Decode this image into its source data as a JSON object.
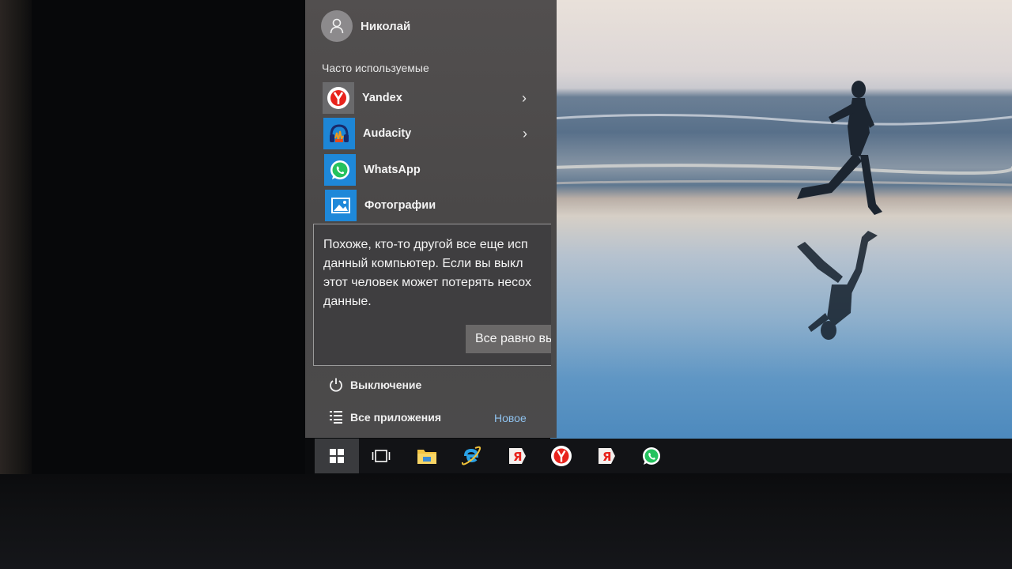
{
  "user": {
    "name": "Николай"
  },
  "start_menu": {
    "section_label": "Часто используемые",
    "apps": [
      {
        "label": "Yandex",
        "icon": "yandex-browser-icon",
        "has_submenu": true
      },
      {
        "label": "Audacity",
        "icon": "audacity-icon",
        "has_submenu": true
      },
      {
        "label": "WhatsApp",
        "icon": "whatsapp-icon",
        "has_submenu": false
      },
      {
        "label": "Фотографии",
        "icon": "photos-icon",
        "has_submenu": false
      }
    ],
    "power_label": "Выключение",
    "all_apps_label": "Все приложения",
    "new_label": "Новое"
  },
  "dialog": {
    "lines": [
      "Похоже, кто-то другой все еще исп",
      "данный компьютер. Если вы выкл",
      "этот человек может потерять несох",
      "данные."
    ],
    "button_label": "Все равно вы"
  },
  "taskbar": {
    "items": [
      "windows-start-icon",
      "task-view-icon",
      "file-explorer-icon",
      "internet-explorer-icon",
      "yandex-icon",
      "yandex-browser-icon",
      "yandex-icon",
      "whatsapp-icon"
    ]
  },
  "colors": {
    "menu_bg": "#4b4a4b",
    "tile_blue": "#1e88d9",
    "accent_new": "#8fc2ee",
    "taskbar_bg": "#121316"
  }
}
